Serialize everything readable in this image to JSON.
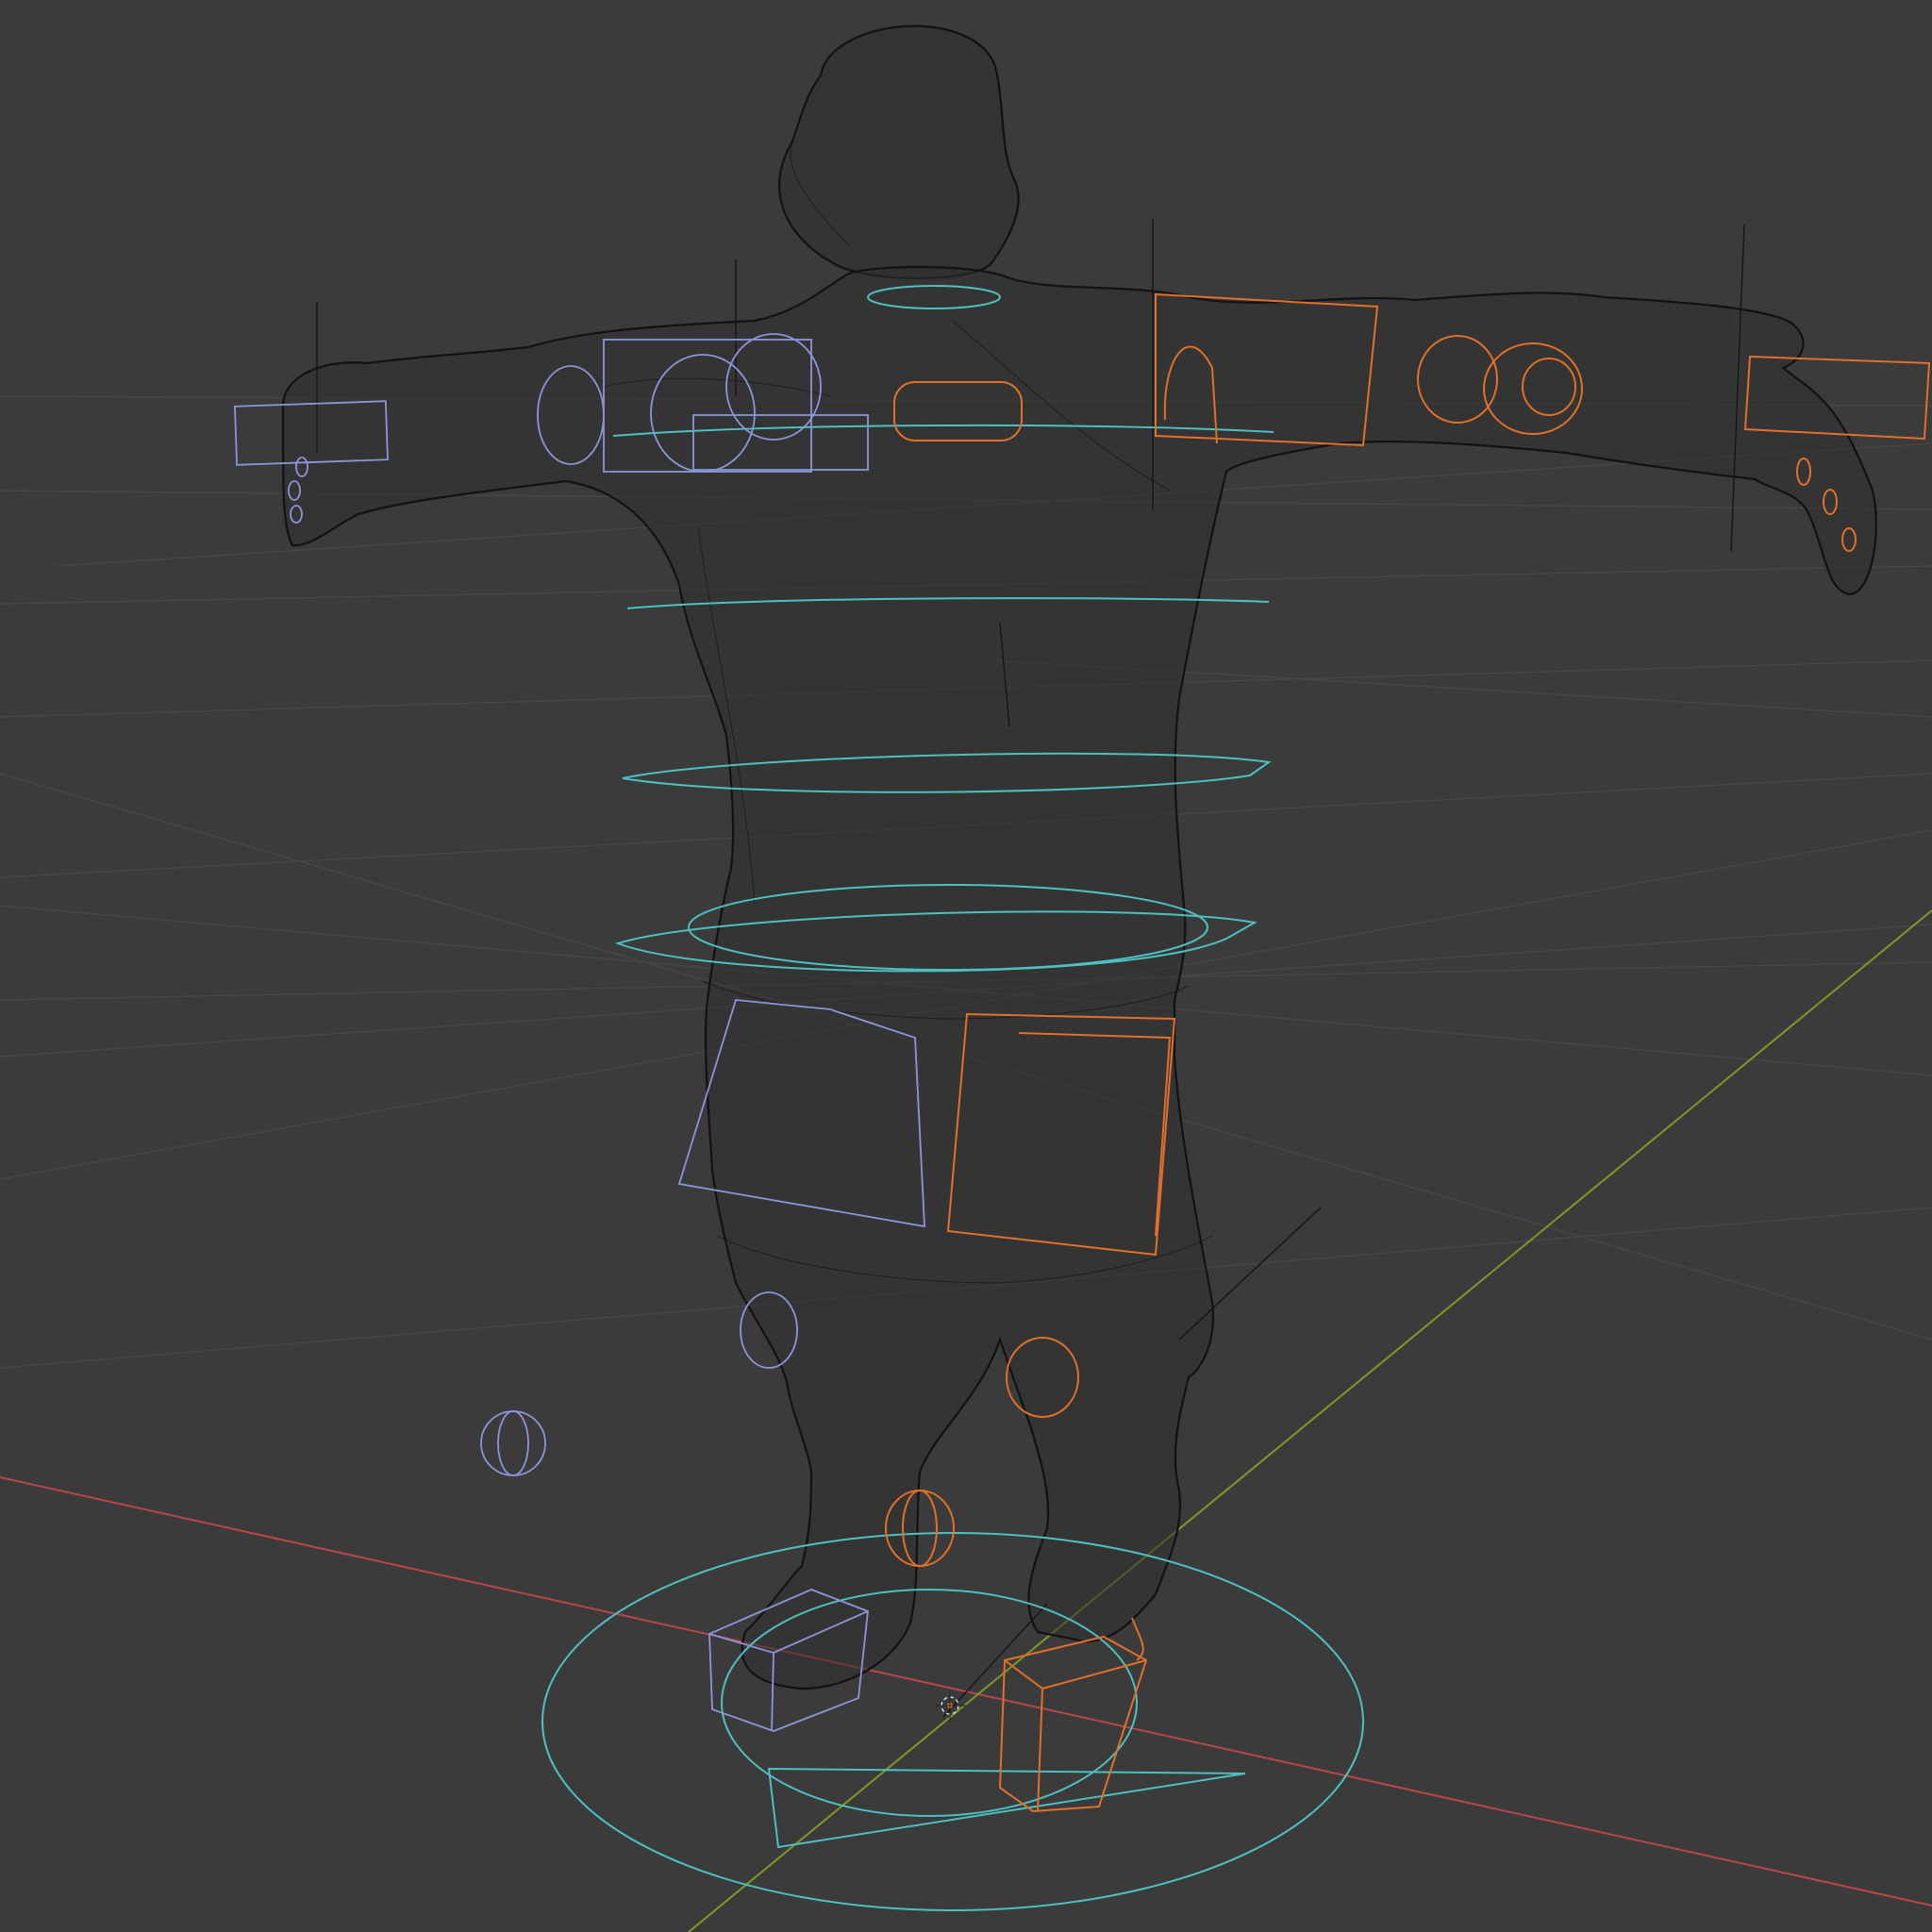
{
  "viewport": {
    "shading_mode": "wireframe",
    "background_color": "#3b3b3b",
    "grid_color": "#474747",
    "x_axis_color": "#b8464a",
    "y_axis_color": "#7c9a26",
    "wireframe_color": "#121212",
    "controls": {
      "center_color": "#4fc0c0",
      "left_color": "#8c95d8",
      "right_color": "#e0702a"
    }
  },
  "scene": {
    "objects": [
      {
        "name_id": "character-mesh",
        "type": "mesh"
      },
      {
        "name_id": "rig-armature",
        "type": "armature"
      },
      {
        "name_id": "root-control",
        "type": "control"
      },
      {
        "name_id": "3d-cursor",
        "type": "cursor"
      }
    ]
  }
}
